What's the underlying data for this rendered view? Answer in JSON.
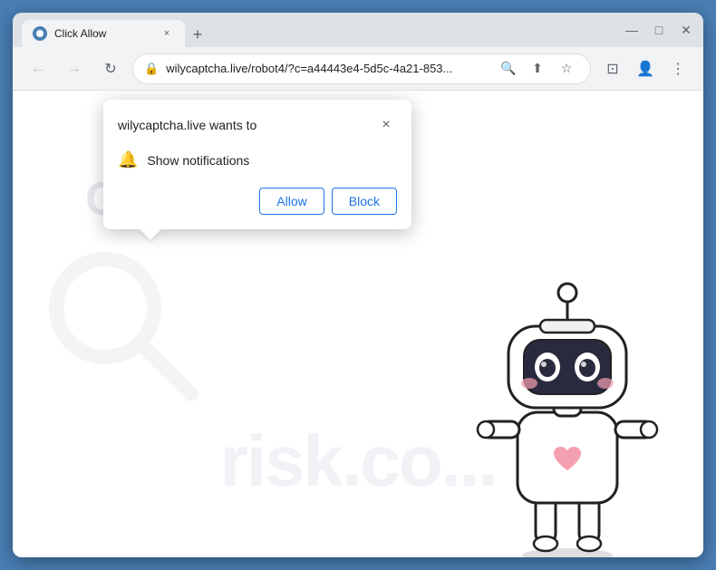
{
  "window": {
    "title": "Click Allow",
    "favicon": "globe-icon"
  },
  "tab": {
    "label": "Click Allow",
    "close_label": "×"
  },
  "new_tab_button": "+",
  "window_controls": {
    "minimize": "—",
    "maximize": "□",
    "close": "✕"
  },
  "nav": {
    "back_icon": "←",
    "forward_icon": "→",
    "reload_icon": "↻",
    "address": "wilycaptcha.live/robot4/?c=a44443e4-5d5c-4a21-853...",
    "lock_icon": "🔒",
    "search_icon": "🔍",
    "share_icon": "⬆",
    "star_icon": "☆",
    "extension_icon": "⊡",
    "account_icon": "👤",
    "menu_icon": "⋮"
  },
  "page": {
    "watermark_text": "risk.co...",
    "page_text": "OU"
  },
  "popup": {
    "title": "wilycaptcha.live wants to",
    "close_icon": "×",
    "permission_label": "Show notifications",
    "allow_label": "Allow",
    "block_label": "Block"
  }
}
